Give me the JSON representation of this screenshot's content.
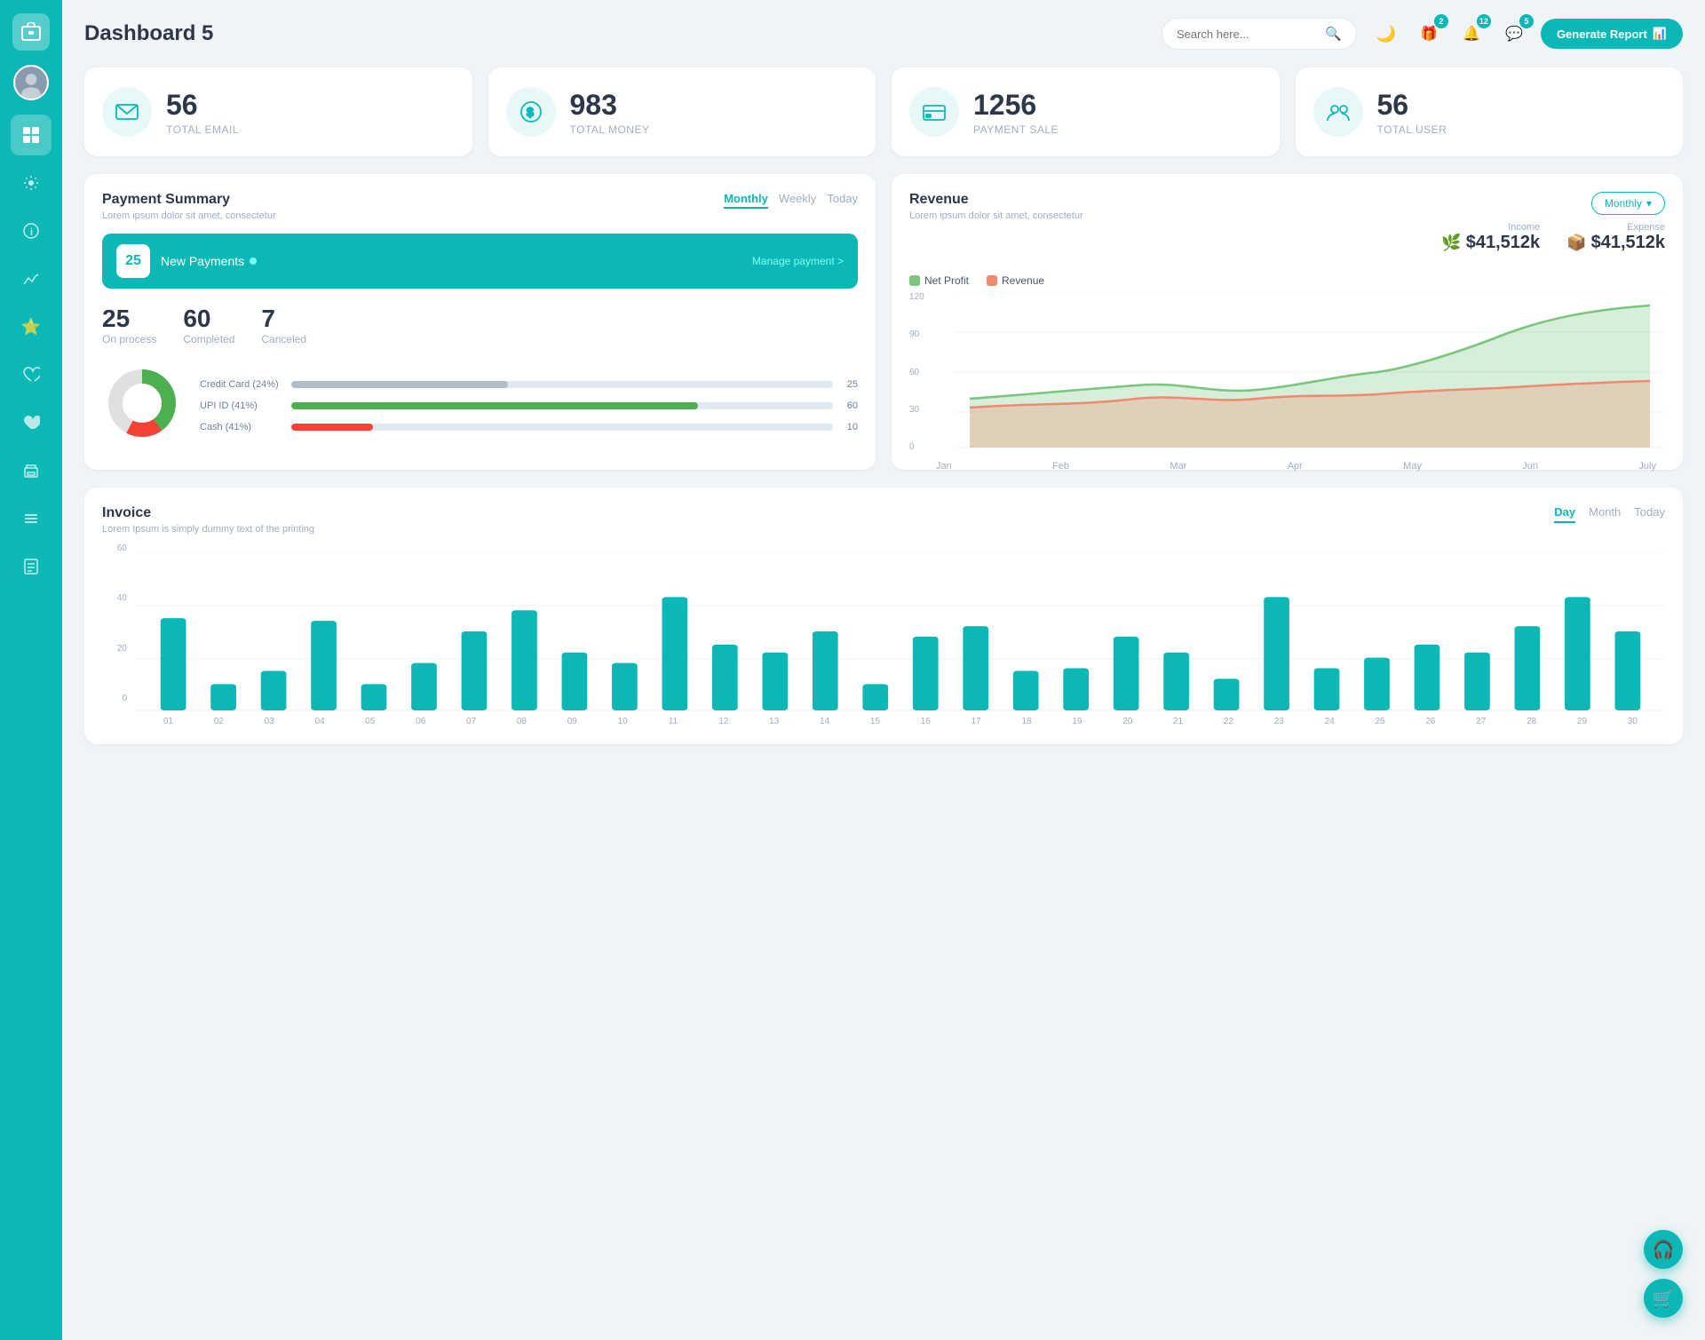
{
  "sidebar": {
    "logo_icon": "💼",
    "items": [
      {
        "name": "sidebar-item-dashboard",
        "icon": "⊞",
        "active": true
      },
      {
        "name": "sidebar-item-settings",
        "icon": "⚙"
      },
      {
        "name": "sidebar-item-info",
        "icon": "ℹ"
      },
      {
        "name": "sidebar-item-analytics",
        "icon": "📊"
      },
      {
        "name": "sidebar-item-star",
        "icon": "★"
      },
      {
        "name": "sidebar-item-heart",
        "icon": "♥"
      },
      {
        "name": "sidebar-item-heart2",
        "icon": "❤"
      },
      {
        "name": "sidebar-item-print",
        "icon": "🖨"
      },
      {
        "name": "sidebar-item-list",
        "icon": "☰"
      },
      {
        "name": "sidebar-item-docs",
        "icon": "📋"
      }
    ]
  },
  "header": {
    "title": "Dashboard 5",
    "search_placeholder": "Search here...",
    "dark_mode_icon": "🌙",
    "notification_icons": [
      {
        "name": "gift-icon",
        "icon": "🎁",
        "badge": "2"
      },
      {
        "name": "bell-icon",
        "icon": "🔔",
        "badge": "12"
      },
      {
        "name": "message-icon",
        "icon": "💬",
        "badge": "5"
      }
    ],
    "generate_report_label": "Generate Report"
  },
  "stat_cards": [
    {
      "id": "total-email",
      "icon": "📋",
      "value": "56",
      "label": "TOTAL EMAIL"
    },
    {
      "id": "total-money",
      "icon": "$",
      "value": "983",
      "label": "TOTAL MONEY"
    },
    {
      "id": "payment-sale",
      "icon": "💳",
      "value": "1256",
      "label": "PAYMENT SALE"
    },
    {
      "id": "total-user",
      "icon": "👥",
      "value": "56",
      "label": "TOTAL USER"
    }
  ],
  "payment_summary": {
    "title": "Payment Summary",
    "subtitle": "Lorem ipsum dolor sit amet, consectetur",
    "tabs": [
      "Monthly",
      "Weekly",
      "Today"
    ],
    "active_tab": "Monthly",
    "new_payments_count": "25",
    "new_payments_label": "New Payments",
    "manage_link": "Manage payment >",
    "stats": [
      {
        "value": "25",
        "label": "On process"
      },
      {
        "value": "60",
        "label": "Completed"
      },
      {
        "value": "7",
        "label": "Canceled"
      }
    ],
    "bars": [
      {
        "label": "Credit Card (24%)",
        "fill_color": "#b0bec5",
        "width": 40,
        "value": "25"
      },
      {
        "label": "UPI ID (41%)",
        "fill_color": "#4caf50",
        "width": 75,
        "value": "60"
      },
      {
        "label": "Cash (41%)",
        "fill_color": "#f44336",
        "width": 15,
        "value": "10"
      }
    ],
    "donut": {
      "segments": [
        {
          "color": "#4caf50",
          "pct": 41
        },
        {
          "color": "#f44336",
          "pct": 18
        },
        {
          "color": "#e0e0e0",
          "pct": 41
        }
      ]
    }
  },
  "revenue": {
    "title": "Revenue",
    "subtitle": "Lorem ipsum dolor sit amet, consectetur",
    "dropdown_label": "Monthly",
    "legend": [
      {
        "label": "Net Profit",
        "color": "#7bc67e"
      },
      {
        "label": "Revenue",
        "color": "#ef8a6f"
      }
    ],
    "income": {
      "label": "Income",
      "value": "$41,512k",
      "icon": "📈"
    },
    "expense": {
      "label": "Expense",
      "value": "$41,512k",
      "icon": "📦"
    },
    "chart": {
      "x_labels": [
        "Jan",
        "Feb",
        "Mar",
        "Apr",
        "May",
        "Jun",
        "July"
      ],
      "y_labels": [
        "120",
        "90",
        "60",
        "30",
        "0"
      ]
    }
  },
  "invoice": {
    "title": "Invoice",
    "subtitle": "Lorem Ipsum is simply dummy text of the printing",
    "tabs": [
      "Day",
      "Month",
      "Today"
    ],
    "active_tab": "Day",
    "y_labels": [
      "60",
      "40",
      "20",
      "0"
    ],
    "x_labels": [
      "01",
      "02",
      "03",
      "04",
      "05",
      "06",
      "07",
      "08",
      "09",
      "10",
      "11",
      "12",
      "13",
      "14",
      "15",
      "16",
      "17",
      "18",
      "19",
      "20",
      "21",
      "22",
      "23",
      "24",
      "25",
      "26",
      "27",
      "28",
      "29",
      "30"
    ],
    "bar_values": [
      35,
      10,
      15,
      34,
      10,
      18,
      30,
      38,
      22,
      18,
      43,
      25,
      22,
      30,
      10,
      28,
      32,
      15,
      16,
      28,
      22,
      12,
      43,
      16,
      20,
      25,
      22,
      32,
      43,
      30
    ]
  },
  "fabs": {
    "support_icon": "🎧",
    "cart_icon": "🛒"
  }
}
